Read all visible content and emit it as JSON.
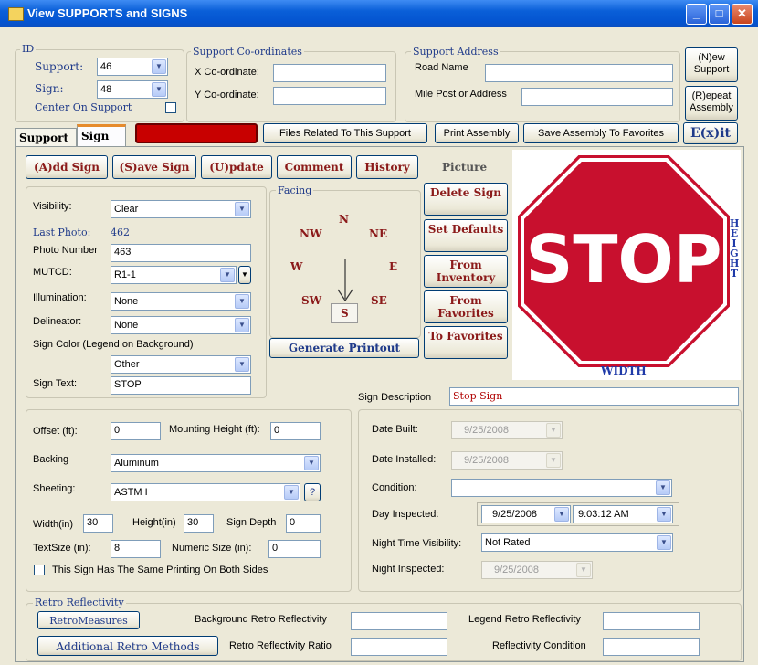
{
  "window": {
    "title": "View SUPPORTS and SIGNS"
  },
  "id_group": {
    "title": "ID",
    "support_label": "Support:",
    "support_value": "46",
    "sign_label": "Sign:",
    "sign_value": "48",
    "center_label": "Center On Support"
  },
  "coords": {
    "title": "Support Co-ordinates",
    "x_label": "X Co-ordinate:",
    "y_label": "Y Co-ordinate:",
    "x_value": "",
    "y_value": ""
  },
  "address": {
    "title": "Support Address",
    "road_label": "Road Name",
    "mile_label": "Mile Post or Address",
    "road_value": "",
    "mile_value": ""
  },
  "buttons_right": {
    "new_support": "(N)ew Support",
    "repeat_assembly": "(R)epeat Assembly",
    "exit": "E(x)it"
  },
  "tabs": {
    "support": "Support",
    "sign": "Sign"
  },
  "toolbar": {
    "red_button": "",
    "files": "Files Related To This Support",
    "print_assembly": "Print Assembly",
    "save_assembly": "Save Assembly To Favorites"
  },
  "sign_actions": {
    "add": "(A)dd Sign",
    "save": "(S)ave Sign",
    "update": "(U)pdate",
    "comment": "Comment",
    "history": "History",
    "picture": "Picture"
  },
  "side_buttons": {
    "delete": "Delete Sign",
    "defaults": "Set Defaults",
    "inventory": "From Inventory",
    "favorites": "From Favorites",
    "to_favorites": "To Favorites",
    "printout": "Generate Printout"
  },
  "facing": {
    "title": "Facing",
    "n": "N",
    "ne": "NE",
    "e": "E",
    "se": "SE",
    "s": "S",
    "sw": "SW",
    "w": "W",
    "nw": "NW"
  },
  "sign_form": {
    "visibility_label": "Visibility:",
    "visibility_value": "Clear",
    "last_photo_label": "Last Photo:",
    "last_photo_value": "462",
    "photo_number_label": "Photo Number",
    "photo_number_value": "463",
    "mutcd_label": "MUTCD:",
    "mutcd_value": "R1-1",
    "illumination_label": "Illumination:",
    "illumination_value": "None",
    "delineator_label": "Delineator:",
    "delineator_value": "None",
    "color_label": "Sign Color (Legend on Background)",
    "color_value": "Other",
    "text_label": "Sign Text:",
    "text_value": "STOP"
  },
  "picture": {
    "stop_text": "STOP",
    "height_label": "HEIGHT",
    "width_label": "WIDTH",
    "stop_color": "#c8102e"
  },
  "description": {
    "label": "Sign Description",
    "value": "Stop Sign"
  },
  "dims": {
    "offset_label": "Offset (ft):",
    "offset_value": "0",
    "mount_label": "Mounting Height (ft):",
    "mount_value": "0",
    "backing_label": "Backing",
    "backing_value": "Aluminum",
    "sheeting_label": "Sheeting:",
    "sheeting_value": "ASTM I",
    "help": "?",
    "width_label": "Width(in)",
    "width_value": "30",
    "height_label": "Height(in)",
    "height_value": "30",
    "depth_label": "Sign Depth",
    "depth_value": "0",
    "textsize_label": "TextSize (in):",
    "textsize_value": "8",
    "numeric_label": "Numeric Size (in):",
    "numeric_value": "0",
    "both_sides_label": "This Sign Has The Same Printing On Both Sides"
  },
  "dates": {
    "built_label": "Date Built:",
    "built_value": "9/25/2008",
    "installed_label": "Date Installed:",
    "installed_value": "9/25/2008",
    "condition_label": "Condition:",
    "condition_value": "",
    "inspected_label": "Day Inspected:",
    "inspected_date": "9/25/2008",
    "inspected_time": "9:03:12 AM",
    "night_vis_label": "Night Time Visibility:",
    "night_vis_value": "Not Rated",
    "night_insp_label": "Night Inspected:",
    "night_insp_value": "9/25/2008"
  },
  "retro": {
    "title": "Retro Reflectivity",
    "measures_button": "RetroMeasures",
    "methods_button": "Additional Retro Methods",
    "bg_label": "Background Retro Reflectivity",
    "ratio_label": "Retro Reflectivity Ratio",
    "legend_label": "Legend Retro Reflectivity",
    "condition_label": "Reflectivity Condition"
  }
}
